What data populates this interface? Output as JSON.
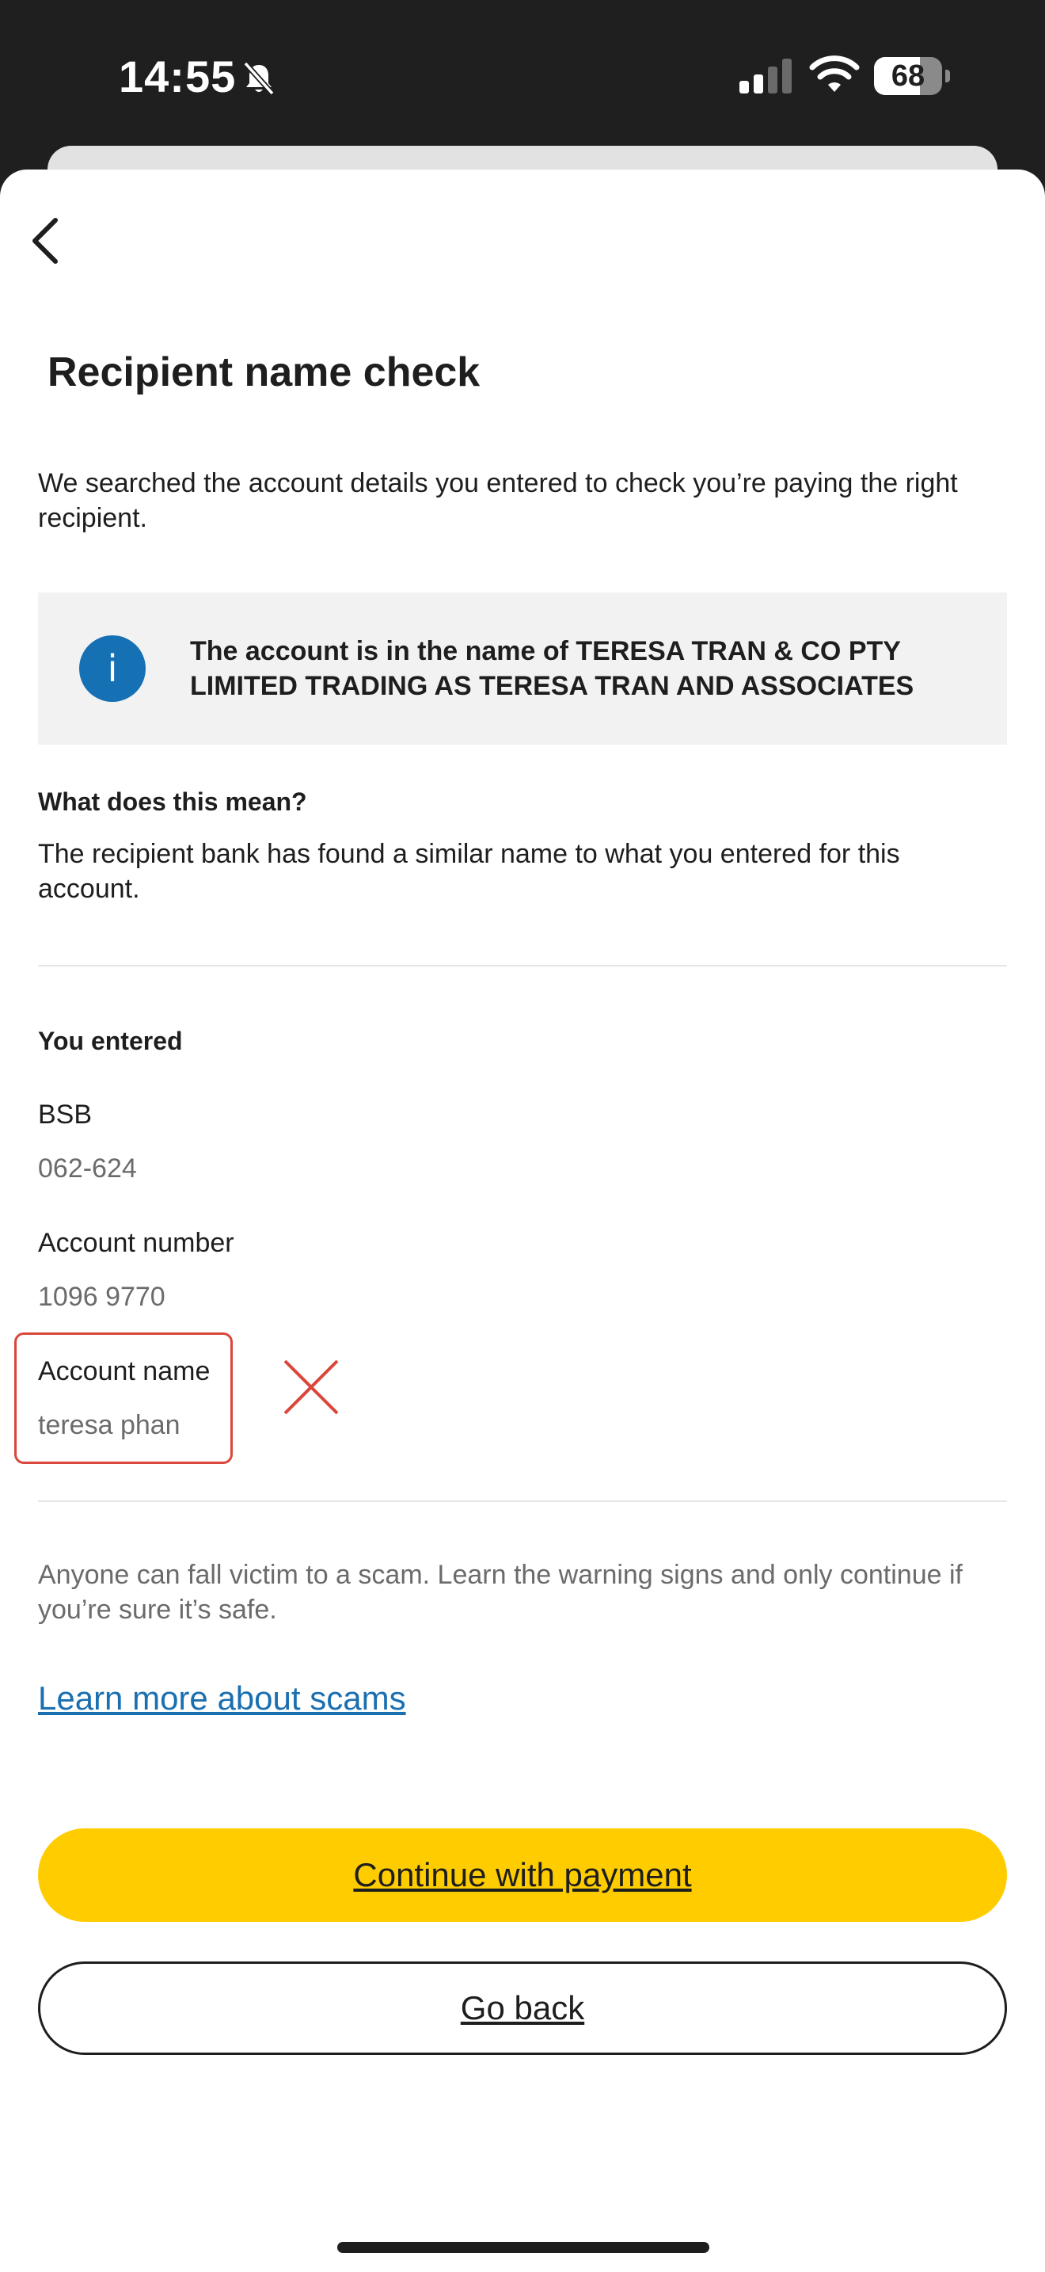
{
  "status_bar": {
    "time": "14:55",
    "battery_level": "68",
    "icons": [
      "bell-slash-icon",
      "signal-icon",
      "wifi-icon",
      "battery-icon"
    ]
  },
  "header": {
    "back_icon": "chevron-left-icon"
  },
  "page": {
    "title": "Recipient name check",
    "intro": "We searched the account details you entered to check you’re paying the right recipient."
  },
  "info_box": {
    "icon": "info-icon",
    "icon_glyph": "i",
    "text": "The account is in the name of TERESA TRAN & CO PTY LIMITED TRADING AS TERESA TRAN AND ASSOCIATES",
    "icon_color": "#1670b4"
  },
  "explanation": {
    "heading": "What does this mean?",
    "text": "The recipient bank has found a similar name to what you entered for this account."
  },
  "entered": {
    "heading": "You entered",
    "bsb_label": "BSB",
    "bsb_value": "062-624",
    "account_number_label": "Account number",
    "account_number_value": "1096 9770",
    "account_name_label": "Account name",
    "account_name_value": "teresa phan",
    "mismatch_icon": "x-mark-icon",
    "mismatch_color": "#d9473a"
  },
  "footer": {
    "disclaimer": "Anyone can fall victim to a scam. Learn the warning signs and only continue if you’re sure it’s safe.",
    "learn_link": "Learn more about scams",
    "continue_label": "Continue with payment",
    "go_back_label": "Go back"
  },
  "colors": {
    "primary_button": "#ffcc00",
    "link": "#1a6fb0",
    "status_bar_bg": "#1f1f1f"
  }
}
